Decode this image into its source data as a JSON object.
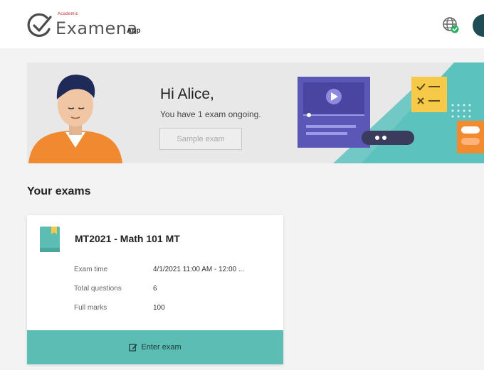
{
  "header": {
    "brand_small": "Academic",
    "app_name": "Examena",
    "app_suffix": "App",
    "globe_icon": "globe-check-icon",
    "avatar_icon": "user-avatar",
    "colors": {
      "logo_check": "#4a4a4a",
      "accent": "#27ae60",
      "avatar": "#1f4d55"
    }
  },
  "banner": {
    "greeting": "Hi Alice,",
    "subtext": "You have 1 exam ongoing.",
    "sample_button": "Sample exam",
    "colors": {
      "background": "#e8e8e8",
      "teal": "#5cc2bd",
      "purple": "#5b57b7",
      "yellow": "#f7c948",
      "orange": "#f28b30"
    }
  },
  "exams": {
    "section_title": "Your exams",
    "cards": [
      {
        "title": "MT2021 - Math 101 MT",
        "icon": "book-icon",
        "rows": [
          {
            "label": "Exam time",
            "value": "4/1/2021 11:00 AM - 12:00 ..."
          },
          {
            "label": "Total questions",
            "value": "6"
          },
          {
            "label": "Full marks",
            "value": "100"
          }
        ],
        "enter_button": "Enter exam",
        "enter_icon": "edit-icon"
      }
    ],
    "colors": {
      "card_button": "#5cbdb5",
      "book": "#5cbdb5",
      "bookmark": "#f7c948"
    }
  }
}
